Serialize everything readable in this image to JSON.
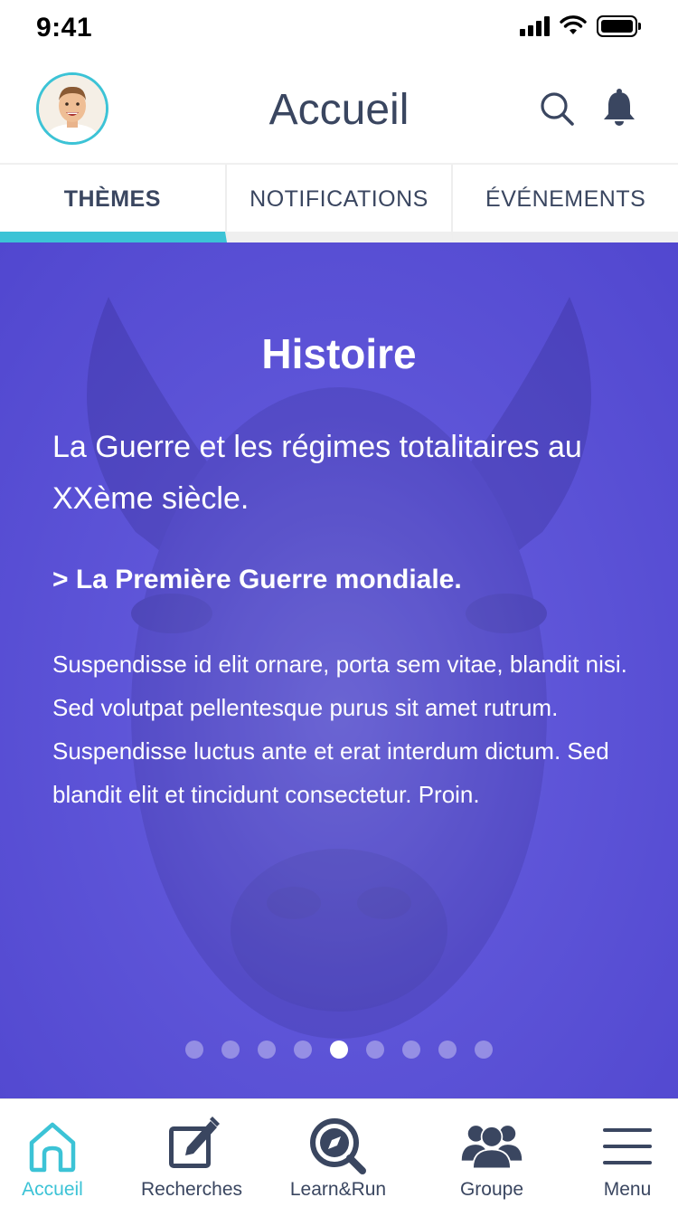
{
  "status_bar": {
    "time": "9:41"
  },
  "header": {
    "title": "Accueil"
  },
  "tabs": [
    {
      "label": "THÈMES",
      "active": true
    },
    {
      "label": "NOTIFICATIONS",
      "active": false
    },
    {
      "label": "ÉVÉNEMENTS",
      "active": false
    }
  ],
  "hero": {
    "title": "Histoire",
    "subtitle": "La Guerre et les régimes totalitaires au XXème siècle.",
    "chapter": "> La Première Guerre mondiale.",
    "body": "Suspendisse id elit ornare, porta sem vitae, blandit nisi. Sed volutpat pellentesque purus sit amet rutrum. Suspendisse luctus ante et erat interdum dictum. Sed blandit elit et tincidunt consectetur. Proin.",
    "carousel": {
      "count": 9,
      "active_index": 4
    }
  },
  "bottom_nav": [
    {
      "label": "Accueil",
      "icon": "home-icon",
      "active": true
    },
    {
      "label": "Recherches",
      "icon": "edit-icon",
      "active": false
    },
    {
      "label": "Learn&Run",
      "icon": "compass-search-icon",
      "active": false
    },
    {
      "label": "Groupe",
      "icon": "group-icon",
      "active": false
    },
    {
      "label": "Menu",
      "icon": "menu-icon",
      "active": false
    }
  ],
  "colors": {
    "accent": "#3cc3d6",
    "text": "#3a4660",
    "hero": "#5e55d8"
  }
}
